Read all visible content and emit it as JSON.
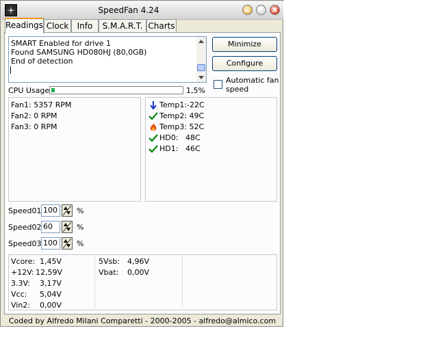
{
  "window": {
    "title": "SpeedFan 4.24"
  },
  "tabs": [
    "Readings",
    "Clock",
    "Info",
    "S.M.A.R.T.",
    "Charts"
  ],
  "log": {
    "lines": [
      "SMART Enabled for drive 1",
      "Found SAMSUNG HD080HJ (80,0GB)",
      "End of detection"
    ]
  },
  "buttons": {
    "minimize": "Minimize",
    "configure": "Configure"
  },
  "auto_fan": {
    "label_line1": "Automatic fan",
    "label_line2": "speed",
    "checked": false
  },
  "cpu": {
    "label": "CPU Usage",
    "value": "1,5%",
    "fraction": 0.015
  },
  "fans": [
    {
      "name": "Fan1:",
      "value": "5357 RPM"
    },
    {
      "name": "Fan2:",
      "value": "0 RPM"
    },
    {
      "name": "Fan3:",
      "value": "0 RPM"
    }
  ],
  "temps": [
    {
      "name": "Temp1:",
      "value": "-22C",
      "icon": "arrow-down-icon"
    },
    {
      "name": "Temp2:",
      "value": "49C",
      "icon": "check-icon"
    },
    {
      "name": "Temp3:",
      "value": "52C",
      "icon": "flame-icon"
    },
    {
      "name": "HD0:",
      "value": "48C",
      "icon": "check-icon"
    },
    {
      "name": "HD1:",
      "value": "46C",
      "icon": "check-icon"
    }
  ],
  "speeds": [
    {
      "label": "Speed01:",
      "value": "100",
      "unit": "%"
    },
    {
      "label": "Speed02:",
      "value": "60",
      "unit": "%"
    },
    {
      "label": "Speed03:",
      "value": "100",
      "unit": "%"
    }
  ],
  "voltages_col1": [
    {
      "name": "Vcore:",
      "value": "1,45V"
    },
    {
      "name": "+12V:",
      "value": "12,59V"
    },
    {
      "name": "3.3V:",
      "value": "3,17V"
    },
    {
      "name": "Vcc:",
      "value": "5,04V"
    },
    {
      "name": "Vin2:",
      "value": "0,00V"
    }
  ],
  "voltages_col2": [
    {
      "name": "5Vsb:",
      "value": "4,96V"
    },
    {
      "name": "Vbat:",
      "value": "0,00V"
    }
  ],
  "footer": "Coded by Alfredo Milani Comparetti - 2000-2005 - alfredo@almico.com",
  "colors": {
    "accent_tab": "#e69a17",
    "cpu_bar": "#22b14c",
    "check": "#0e8a16",
    "arrow": "#1535c8",
    "flame": "#e84a0c"
  }
}
